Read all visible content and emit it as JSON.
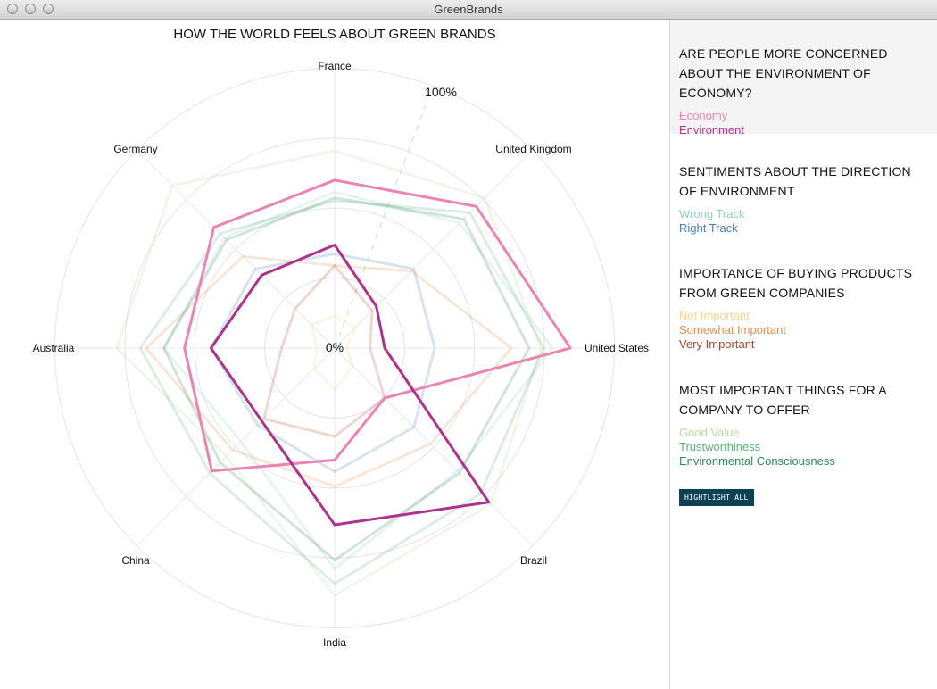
{
  "window": {
    "title": "GreenBrands"
  },
  "colors": {
    "Economy": "#ee82b0",
    "Environment": "#b0308e",
    "Wrong Track": "#8fcfc8",
    "Right Track": "#4a7fb5",
    "Not Important": "#f8d58a",
    "Somewhat Important": "#e0904f",
    "Very Important": "#a8472d",
    "Good Value": "#b6dc9e",
    "Trustworthiness": "#5ab37a",
    "Environmental Consciousness": "#2f8a56"
  },
  "sidebar": {
    "sections": [
      {
        "title": "ARE PEOPLE MORE CONCERNED ABOUT THE ENVIRONMENT OF ECONOMY?",
        "items": [
          "Economy",
          "Environment"
        ],
        "active": true
      },
      {
        "title": "SENTIMENTS ABOUT THE DIRECTION OF ENVIRONMENT",
        "items": [
          "Wrong Track",
          "Right Track"
        ],
        "active": false
      },
      {
        "title": "IMPORTANCE OF BUYING PRODUCTS FROM GREEN COMPANIES",
        "items": [
          "Not Important",
          "Somewhat Important",
          "Very Important"
        ],
        "active": false
      },
      {
        "title": "MOST IMPORTANT THINGS FOR A COMPANY TO OFFER",
        "items": [
          "Good Value",
          "Trustworthiness",
          "Environmental Consciousness"
        ],
        "active": false
      }
    ],
    "button_label": "HIGHTLIGHT ALL"
  },
  "chart_data": {
    "type": "radar",
    "title": "HOW THE WORLD FEELS ABOUT GREEN BRANDS",
    "categories": [
      "France",
      "United Kingdom",
      "United States",
      "Brazil",
      "India",
      "China",
      "Australia",
      "Germany"
    ],
    "scale_label_max": "100%",
    "scale_label_min": "0%",
    "range": [
      0,
      100
    ],
    "grid": true,
    "highlighted": [
      "Economy",
      "Environment"
    ],
    "series": [
      {
        "name": "Economy",
        "values": [
          57,
          68,
          80,
          24,
          38,
          59,
          51,
          58
        ]
      },
      {
        "name": "Environment",
        "values": [
          35,
          20,
          17,
          74,
          60,
          35,
          42,
          35
        ]
      },
      {
        "name": "Wrong Track",
        "values": [
          53,
          60,
          74,
          59,
          75,
          45,
          58,
          53
        ]
      },
      {
        "name": "Right Track",
        "values": [
          32,
          38,
          34,
          38,
          42,
          37,
          42,
          38
        ]
      },
      {
        "name": "Not Important",
        "values": [
          11,
          10,
          4,
          9,
          14,
          10,
          6,
          11
        ]
      },
      {
        "name": "Somewhat Important",
        "values": [
          28,
          37,
          60,
          46,
          47,
          49,
          64,
          44
        ]
      },
      {
        "name": "Very Important",
        "values": [
          28,
          18,
          12,
          24,
          30,
          34,
          18,
          19
        ]
      },
      {
        "name": "Good Value",
        "values": [
          67,
          72,
          70,
          75,
          84,
          52,
          74,
          78
        ]
      },
      {
        "name": "Trustworthiness",
        "values": [
          50,
          65,
          71,
          70,
          80,
          60,
          66,
          55
        ]
      },
      {
        "name": "Environmental Consciousness",
        "values": [
          51,
          62,
          66,
          60,
          72,
          55,
          58,
          52
        ]
      }
    ]
  }
}
